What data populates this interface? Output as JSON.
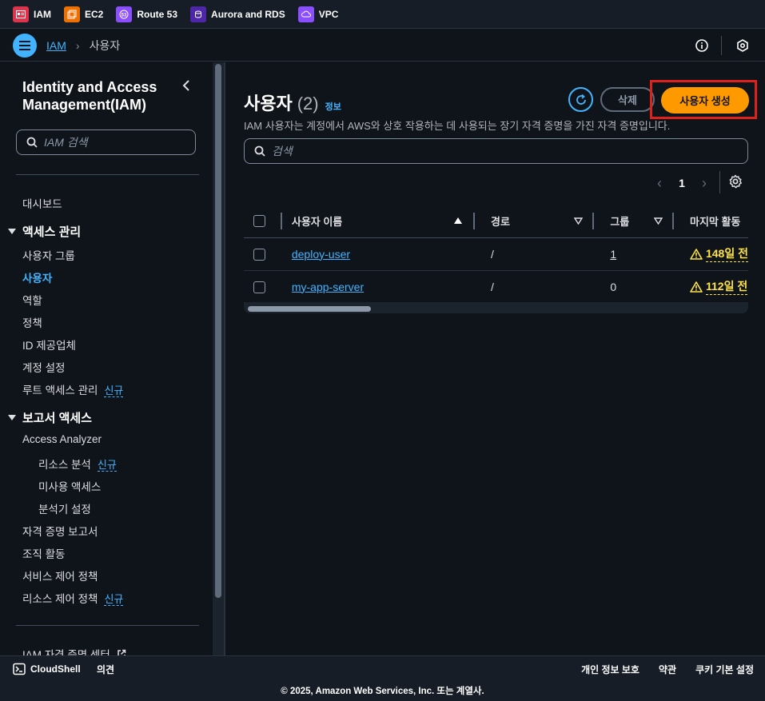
{
  "favorites": [
    {
      "label": "IAM",
      "color": "#dd344c"
    },
    {
      "label": "EC2",
      "color": "#ed7100"
    },
    {
      "label": "Route 53",
      "color": "#8c4fff"
    },
    {
      "label": "Aurora and RDS",
      "color": "#4d27a8"
    },
    {
      "label": "VPC",
      "color": "#8c4fff"
    }
  ],
  "breadcrumb": {
    "root": "IAM",
    "current": "사용자"
  },
  "sidebar": {
    "title": "Identity and Access Management(IAM)",
    "search_placeholder": "IAM 검색",
    "dashboard": "대시보드",
    "access_mgmt": {
      "label": "액세스 관리",
      "items": [
        "사용자 그룹",
        "사용자",
        "역할",
        "정책",
        "ID 제공업체",
        "계정 설정"
      ],
      "root_access": "루트 액세스 관리",
      "new_badge": "신규"
    },
    "report_access": {
      "label": "보고서 액세스",
      "analyzer": "Access Analyzer",
      "sub_items": [
        "리소스 분석",
        "미사용 액세스",
        "분석기 설정"
      ],
      "new_badge": "신규",
      "items": [
        "자격 증명 보고서",
        "조직 활동",
        "서비스 제어 정책",
        "리소스 제어 정책"
      ],
      "rcp_badge": "신규"
    },
    "identity_center": "IAM 자격 증명 센터"
  },
  "main": {
    "title": "사용자",
    "count": "(2)",
    "info_link": "정보",
    "description": "IAM 사용자는 계정에서 AWS와 상호 작용하는 데 사용되는 장기 자격 증명을 가진 자격 증명입니다.",
    "delete_label": "삭제",
    "create_label": "사용자 생성",
    "search_placeholder": "검색",
    "page": "1",
    "columns": [
      "사용자 이름",
      "경로",
      "그룹",
      "마지막 활동"
    ],
    "rows": [
      {
        "name": "deploy-user",
        "path": "/",
        "groups": "1",
        "last_activity": "148일 전"
      },
      {
        "name": "my-app-server",
        "path": "/",
        "groups": "0",
        "last_activity": "112일 전"
      }
    ]
  },
  "footer": {
    "cloudshell": "CloudShell",
    "feedback": "의견",
    "privacy": "개인 정보 보호",
    "terms": "약관",
    "cookies": "쿠키 기본 설정",
    "copyright": "© 2025, Amazon Web Services, Inc. 또는 계열사."
  }
}
